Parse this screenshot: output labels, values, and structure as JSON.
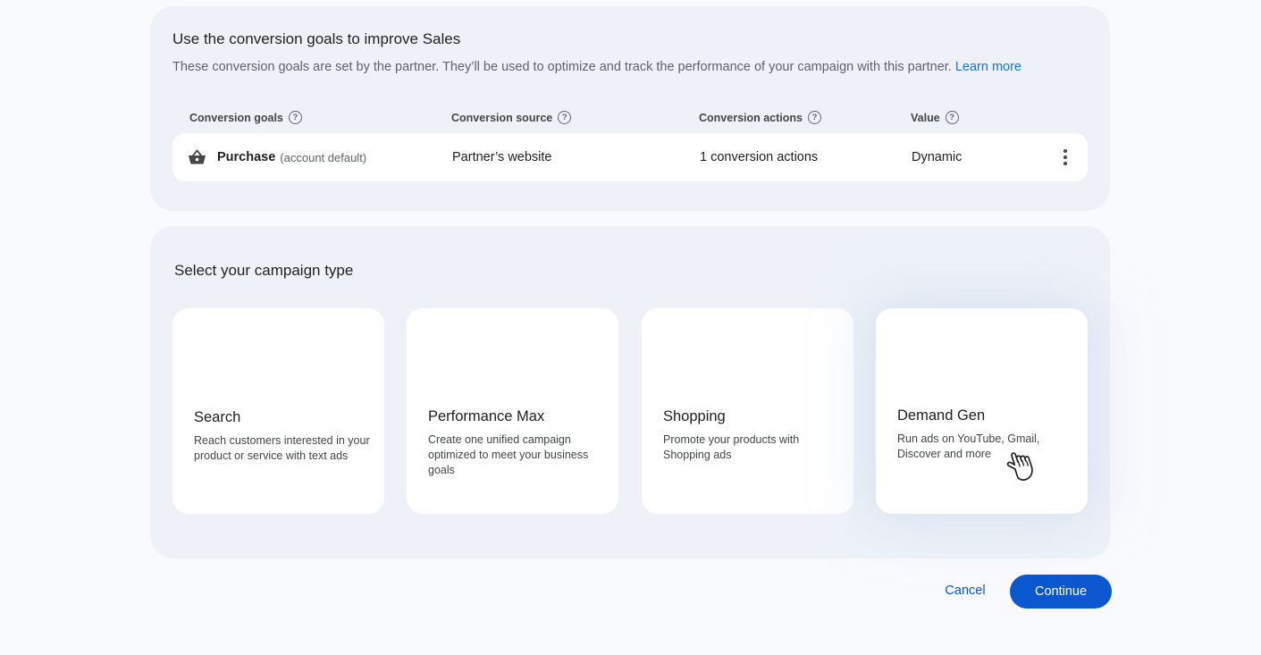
{
  "goals": {
    "title": "Use the conversion goals to improve Sales",
    "description": "These conversion goals are set by the partner. They’ll be used to optimize and track the performance of your campaign with this partner.",
    "learn_more": "Learn more",
    "headers": {
      "goals": "Conversion goals",
      "source": "Conversion source",
      "actions": "Conversion actions",
      "value": "Value"
    },
    "row": {
      "name": "Purchase",
      "note": "(account default)",
      "source": "Partner’s website",
      "actions": "1 conversion actions",
      "value": "Dynamic"
    }
  },
  "campaign": {
    "title": "Select your campaign type",
    "cards": [
      {
        "title": "Search",
        "description": "Reach customers interested in your product or service with text ads"
      },
      {
        "title": "Performance Max",
        "description": "Create one unified campaign optimized to meet your business goals"
      },
      {
        "title": "Shopping",
        "description": "Promote your products with Shopping ads"
      },
      {
        "title": "Demand Gen",
        "description": "Run ads on YouTube, Gmail, Discover and more"
      }
    ]
  },
  "actions": {
    "cancel": "Cancel",
    "continue": "Continue"
  },
  "icons": {
    "purchase": "shopping-basket-icon",
    "help": "help-circle-icon",
    "more": "more-vert-icon",
    "cursor": "hand-pointer-icon"
  },
  "colors": {
    "accent": "#0b57d0",
    "link": "#1a73e8",
    "panel": "#eef2f8"
  }
}
